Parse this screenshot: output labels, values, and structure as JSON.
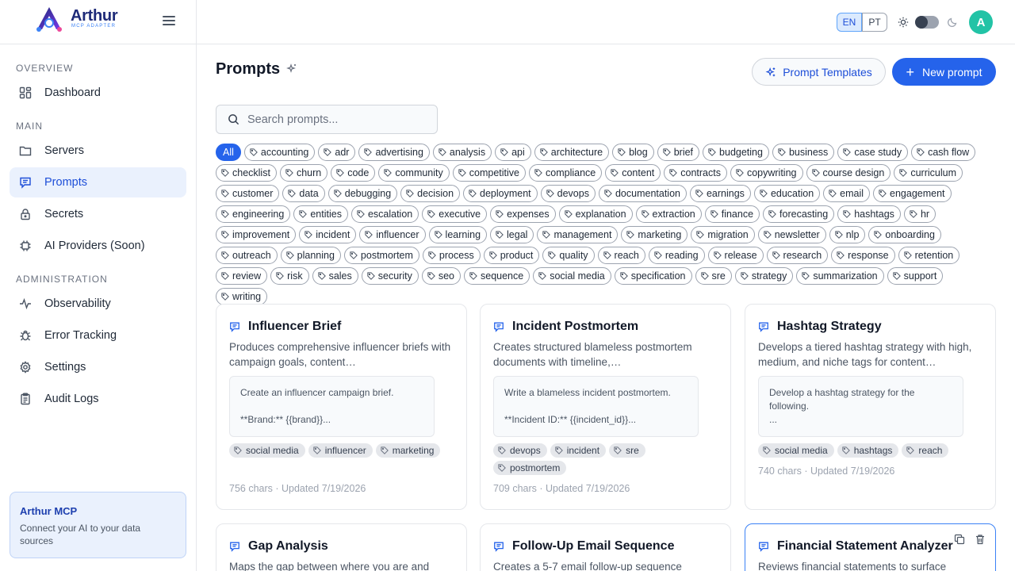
{
  "brand": {
    "name": "Arthur",
    "subtitle": "MCP ADAPTER"
  },
  "sidebar": {
    "sections": [
      {
        "label": "OVERVIEW"
      },
      {
        "label": "MAIN"
      },
      {
        "label": "ADMINISTRATION"
      }
    ],
    "items": [
      {
        "label": "Dashboard",
        "icon": "dashboard-icon"
      },
      {
        "label": "Servers",
        "icon": "folder-icon"
      },
      {
        "label": "Prompts",
        "icon": "chat-icon",
        "active": true
      },
      {
        "label": "Secrets",
        "icon": "lock-icon"
      },
      {
        "label": "AI Providers (Soon)",
        "icon": "chip-icon"
      },
      {
        "label": "Observability",
        "icon": "pulse-icon"
      },
      {
        "label": "Error Tracking",
        "icon": "bug-icon"
      },
      {
        "label": "Settings",
        "icon": "gear-icon"
      },
      {
        "label": "Audit Logs",
        "icon": "clipboard-icon"
      }
    ],
    "promo": {
      "title": "Arthur MCP",
      "text": "Connect your AI to your data sources"
    }
  },
  "header": {
    "languages": [
      "EN",
      "PT"
    ],
    "active_language": "EN",
    "theme": "light",
    "avatar_initial": "A"
  },
  "colors": {
    "accent": "#2563eb",
    "avatar": "#22c3a6",
    "active_bg": "#eaf1fd"
  },
  "main": {
    "title": "Prompts",
    "templates_button": "Prompt Templates",
    "new_button": "New prompt",
    "search_placeholder": "Search prompts...",
    "tags": [
      "All",
      "accounting",
      "adr",
      "advertising",
      "analysis",
      "api",
      "architecture",
      "blog",
      "brief",
      "budgeting",
      "business",
      "case study",
      "cash flow",
      "checklist",
      "churn",
      "code",
      "community",
      "competitive",
      "compliance",
      "content",
      "contracts",
      "copywriting",
      "course design",
      "curriculum",
      "customer",
      "data",
      "debugging",
      "decision",
      "deployment",
      "devops",
      "documentation",
      "earnings",
      "education",
      "email",
      "engagement",
      "engineering",
      "entities",
      "escalation",
      "executive",
      "expenses",
      "explanation",
      "extraction",
      "finance",
      "forecasting",
      "hashtags",
      "hr",
      "improvement",
      "incident",
      "influencer",
      "learning",
      "legal",
      "management",
      "marketing",
      "migration",
      "newsletter",
      "nlp",
      "onboarding",
      "outreach",
      "planning",
      "postmortem",
      "process",
      "product",
      "quality",
      "reach",
      "reading",
      "release",
      "research",
      "response",
      "retention",
      "review",
      "risk",
      "sales",
      "security",
      "seo",
      "sequence",
      "social media",
      "specification",
      "sre",
      "strategy",
      "summarization",
      "support",
      "writing"
    ],
    "selected_tag": "All",
    "cards": [
      {
        "title": "Influencer Brief",
        "description": "Produces comprehensive influencer briefs with campaign goals, content…",
        "preview": "Create an influencer campaign brief.\n\n**Brand:** {{brand}}...",
        "tags": [
          "social media",
          "influencer",
          "marketing"
        ],
        "meta": "756 chars · Updated 7/19/2026"
      },
      {
        "title": "Incident Postmortem",
        "description": "Creates structured blameless postmortem documents with timeline,…",
        "preview": "Write a blameless incident postmortem.\n\n**Incident ID:** {{incident_id}}...",
        "tags": [
          "devops",
          "incident",
          "sre",
          "postmortem"
        ],
        "meta": "709 chars · Updated 7/19/2026"
      },
      {
        "title": "Hashtag Strategy",
        "description": "Develops a tiered hashtag strategy with high, medium, and niche tags for content…",
        "preview": "Develop a hashtag strategy for the following.\n...",
        "tags": [
          "social media",
          "hashtags",
          "reach"
        ],
        "meta": "740 chars · Updated 7/19/2026"
      },
      {
        "title": "Gap Analysis",
        "description": "Maps the gap between where you are and",
        "preview": "",
        "tags": [],
        "meta": ""
      },
      {
        "title": "Follow-Up Email Sequence",
        "description": "Creates a 5-7 email follow-up sequence",
        "preview": "",
        "tags": [],
        "meta": ""
      },
      {
        "title": "Financial Statement Analyzer",
        "description": "Reviews financial statements to surface",
        "preview": "",
        "tags": [],
        "meta": ""
      }
    ]
  }
}
